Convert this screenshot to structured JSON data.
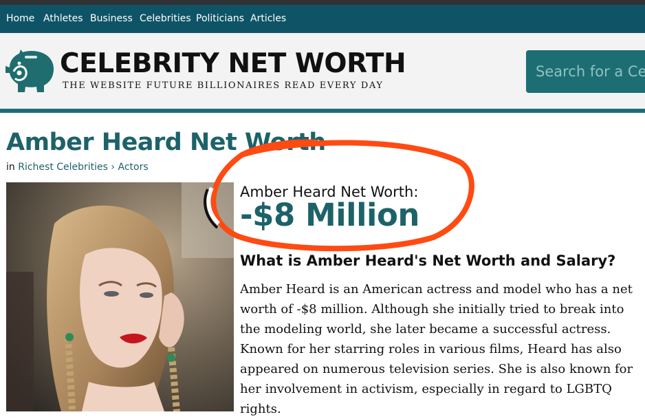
{
  "nav": {
    "items": [
      {
        "label": "Home"
      },
      {
        "label": "Athletes"
      },
      {
        "label": "Business"
      },
      {
        "label": "Celebrities"
      },
      {
        "label": "Politicians"
      },
      {
        "label": "Articles"
      }
    ]
  },
  "header": {
    "logo_title": "CELEBRITY NET WORTH",
    "tagline": "THE WEBSITE FUTURE BILLIONAIRES READ EVERY DAY",
    "logo_icon": "piggy-bank-icon",
    "search_placeholder": "Search for a Cel"
  },
  "article": {
    "title": "Amber Heard Net Worth",
    "breadcrumb": {
      "prefix": "in",
      "category": "Richest Celebrities",
      "separator": "›",
      "subcategory": "Actors"
    },
    "net_worth_label": "Amber Heard Net Worth:",
    "net_worth_value": "-$8 Million",
    "section_heading": "What is Amber Heard's Net Worth and Salary?",
    "body": "Amber Heard is an American actress and model who has a net worth of -$8 million. Although she initially tried to break into the modeling world, she later became a successful actress. Known for her starring roles in various films, Heard has also appeared on numerous television series. She is also known for her involvement in activism, especially in regard to LGBTQ rights."
  },
  "colors": {
    "nav_bg": "#0e5466",
    "brand_teal": "#1d6269",
    "highlight_circle": "#ff4a12"
  }
}
